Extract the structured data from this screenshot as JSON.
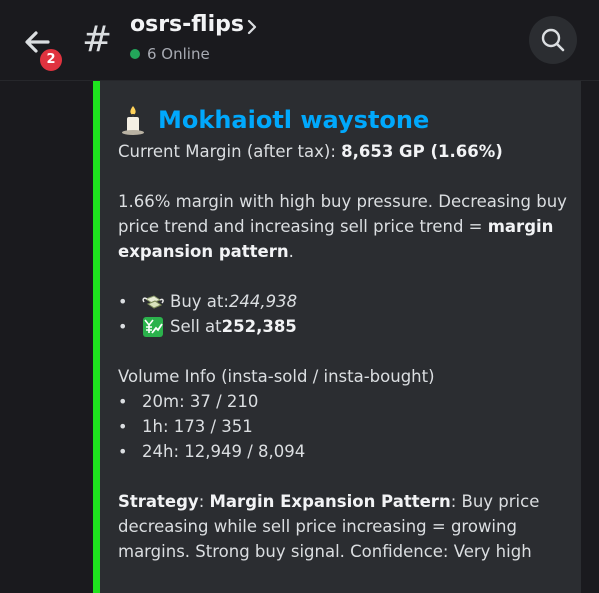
{
  "header": {
    "back_badge": "2",
    "channel_prefix": "#",
    "channel_name": "osrs-flips",
    "online_status": "6 Online"
  },
  "embed": {
    "accent_color": "#1ee31e",
    "title": "Mokhaiotl waystone",
    "margin_label": "Current Margin (after tax): ",
    "margin_value": "8,653 GP (1.66%)",
    "summary_text": "1.66% margin with high buy pressure. Decreasing buy price trend and increasing sell price trend = ",
    "summary_bold": "margin expansion pattern",
    "summary_end": ".",
    "buy_label": "Buy at: ",
    "buy_value": "244,938",
    "sell_label": "Sell at ",
    "sell_value": "252,385",
    "volume_title": "Volume Info (insta-sold / insta-bought)",
    "volume": [
      {
        "text": "20m: 37 / 210"
      },
      {
        "text": "1h: 173 / 351"
      },
      {
        "text": "24h: 12,949 / 8,094"
      }
    ],
    "strategy_label": "Strategy",
    "strategy_sep": ": ",
    "strategy_name": "Margin Expansion Pattern",
    "strategy_text": ": Buy price decreasing while sell price increasing = growing margins. Strong buy signal. Confidence: Very high"
  }
}
